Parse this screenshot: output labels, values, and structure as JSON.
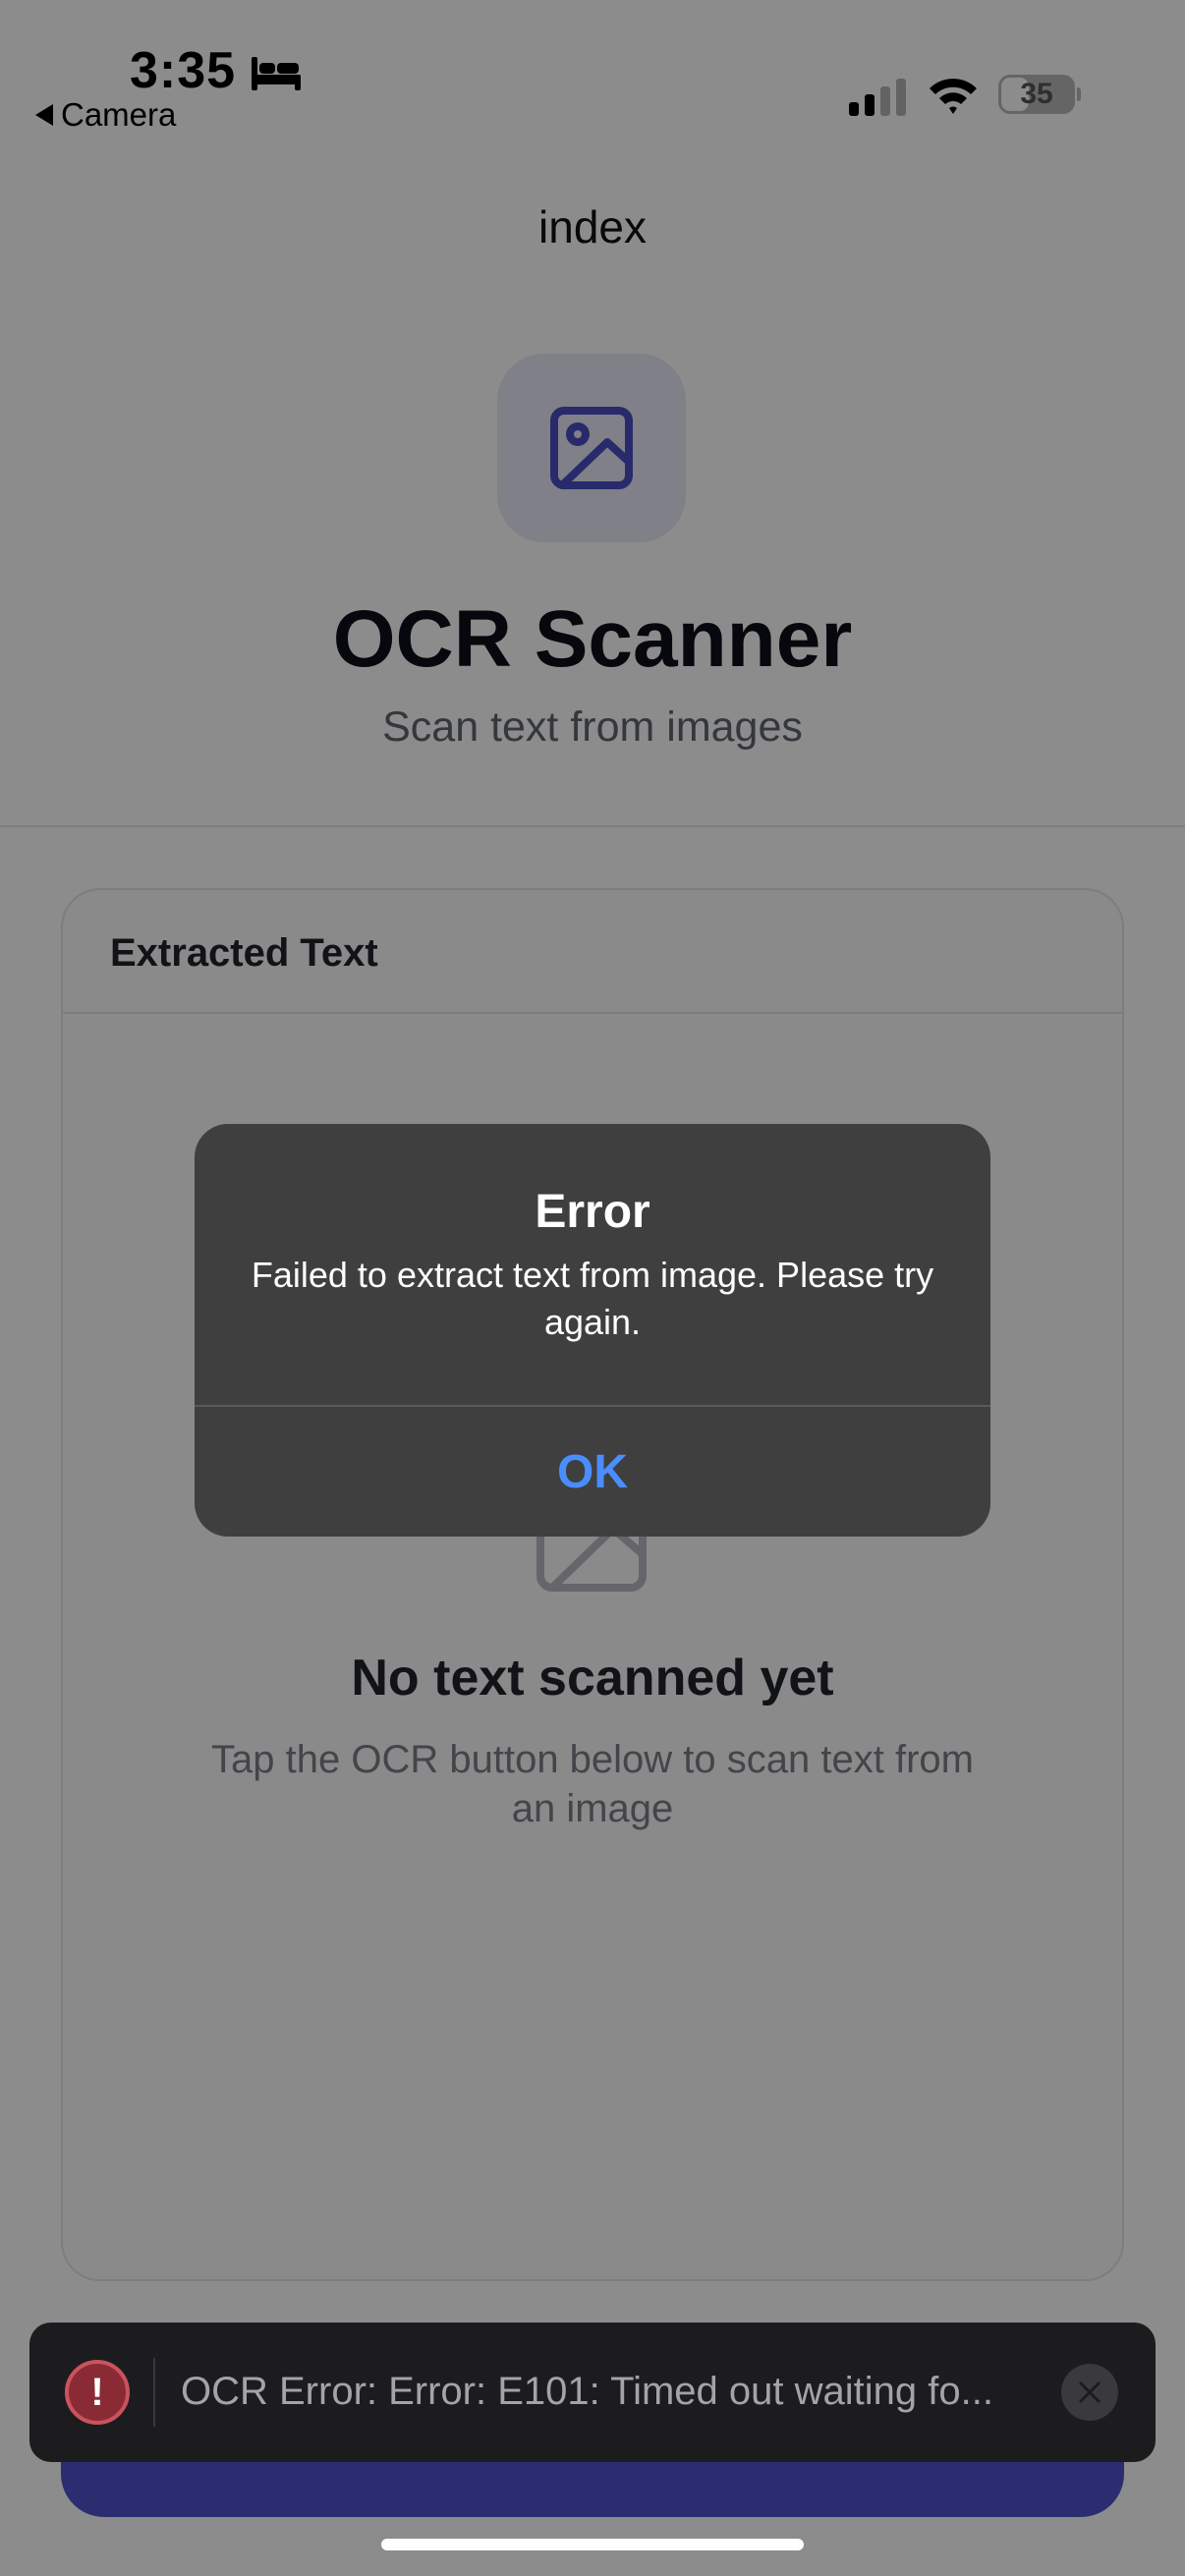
{
  "status_bar": {
    "time": "3:35",
    "back_app": "Camera",
    "battery": "35",
    "icons": [
      "bed-icon",
      "signal-icon",
      "wifi-icon",
      "battery-icon"
    ]
  },
  "nav": {
    "title": "index"
  },
  "header": {
    "icon": "image-icon",
    "title": "OCR Scanner",
    "subtitle": "Scan text from images"
  },
  "card": {
    "title": "Extracted Text",
    "empty_icon": "image-icon",
    "empty_title": "No text scanned yet",
    "empty_description": "Tap the OCR button below to scan text from an image"
  },
  "alert": {
    "title": "Error",
    "message": "Failed to extract text from image. Please try again.",
    "ok_label": "OK"
  },
  "toast": {
    "icon": "error-icon",
    "icon_glyph": "!",
    "message": "OCR Error: Error: E101: Timed out waiting fo...",
    "close_icon": "close-icon"
  },
  "colors": {
    "accent": "#4f52cc",
    "alert_button": "#4a8dff",
    "alert_background": "#3f3f40",
    "toast_background": "#1c1c1e",
    "error": "#8a2a35"
  }
}
